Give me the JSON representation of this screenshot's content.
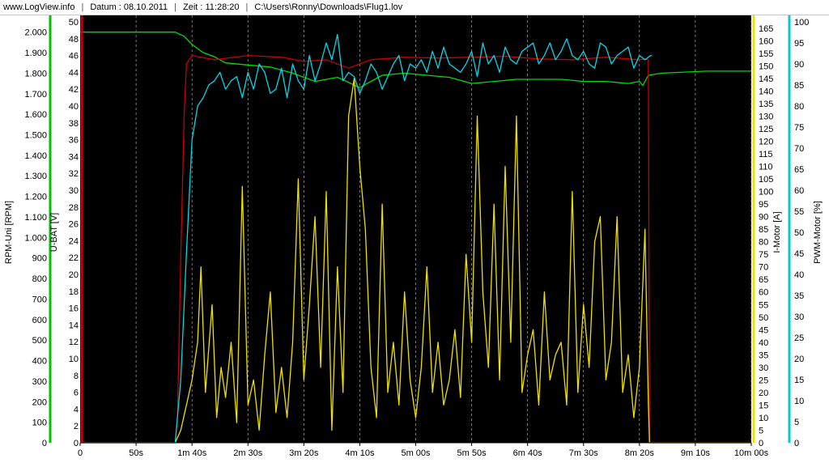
{
  "header": {
    "site": "www.LogView.info",
    "date": "Datum : 08.10.2011",
    "time": "Zeit : 11:28:20",
    "path": "C:\\Users\\Ronny\\Downloads\\Flug1.lov"
  },
  "chart_data": {
    "type": "line",
    "background": "#000000",
    "grid": true,
    "x_axis": {
      "unit": "s",
      "range": [
        0,
        600
      ],
      "ticks": [
        {
          "value": 0,
          "label": "0"
        },
        {
          "value": 50,
          "label": "50s"
        },
        {
          "value": 100,
          "label": "1m 40s"
        },
        {
          "value": 150,
          "label": "2m 30s"
        },
        {
          "value": 200,
          "label": "3m 20s"
        },
        {
          "value": 250,
          "label": "4m 10s"
        },
        {
          "value": 300,
          "label": "5m 00s"
        },
        {
          "value": 350,
          "label": "5m 50s"
        },
        {
          "value": 400,
          "label": "6m 40s"
        },
        {
          "value": 450,
          "label": "7m 30s"
        },
        {
          "value": 500,
          "label": "8m 20s"
        },
        {
          "value": 550,
          "label": "9m 10s"
        },
        {
          "value": 600,
          "label": "10m 00s"
        }
      ]
    },
    "y_axes": [
      {
        "id": "rpm",
        "label": "RPM-Uni [RPM]",
        "color": "#00c000",
        "range": [
          0,
          2050
        ],
        "ticks": [
          "0",
          "100",
          "200",
          "300",
          "400",
          "500",
          "600",
          "700",
          "800",
          "900",
          "1.000",
          "1.100",
          "1.200",
          "1.300",
          "1.400",
          "1.500",
          "1.600",
          "1.700",
          "1.800",
          "1.900",
          "2.000"
        ]
      },
      {
        "id": "ubat",
        "label": "U-BAT [V]",
        "color": "#cc0000",
        "range": [
          0,
          50
        ],
        "ticks": [
          "0",
          "2",
          "4",
          "6",
          "8",
          "10",
          "12",
          "14",
          "16",
          "18",
          "20",
          "22",
          "24",
          "26",
          "28",
          "30",
          "32",
          "34",
          "36",
          "38",
          "40",
          "42",
          "44",
          "46",
          "48",
          "50"
        ]
      },
      {
        "id": "imotor",
        "label": "I-Motor [A]",
        "color": "#f0e000",
        "range": [
          0,
          167.5
        ],
        "ticks": [
          "0",
          "5",
          "10",
          "15",
          "20",
          "25",
          "30",
          "35",
          "40",
          "45",
          "50",
          "55",
          "60",
          "65",
          "70",
          "75",
          "80",
          "85",
          "90",
          "95",
          "100",
          "105",
          "110",
          "115",
          "120",
          "125",
          "130",
          "135",
          "140",
          "145",
          "150",
          "155",
          "160",
          "165"
        ]
      },
      {
        "id": "pwm",
        "label": "PWM-Motor [%]",
        "color": "#00c8d8",
        "range": [
          0,
          100
        ],
        "ticks": [
          "0",
          "5",
          "10",
          "15",
          "20",
          "25",
          "30",
          "35",
          "40",
          "45",
          "50",
          "55",
          "60",
          "65",
          "70",
          "75",
          "80",
          "85",
          "90",
          "95",
          "100"
        ]
      }
    ],
    "series": [
      {
        "name": "RPM-Uni [RPM]",
        "axis": "rpm",
        "color": "#00dd00",
        "x": [
          0,
          85,
          93,
          100,
          110,
          120,
          130,
          150,
          170,
          190,
          210,
          230,
          250,
          270,
          290,
          310,
          330,
          350,
          370,
          390,
          410,
          430,
          450,
          470,
          490,
          500,
          503,
          508,
          520,
          540,
          560,
          580,
          600
        ],
        "y": [
          2000,
          2000,
          1980,
          1940,
          1900,
          1880,
          1850,
          1840,
          1830,
          1800,
          1760,
          1780,
          1730,
          1790,
          1800,
          1790,
          1780,
          1750,
          1760,
          1770,
          1770,
          1770,
          1760,
          1760,
          1750,
          1760,
          1740,
          1790,
          1800,
          1805,
          1810,
          1810,
          1810
        ]
      },
      {
        "name": "U-BAT [V]",
        "axis": "ubat",
        "color": "#cc0000",
        "x": [
          0,
          85,
          87,
          90,
          93,
          95,
          100,
          120,
          150,
          180,
          200,
          220,
          240,
          260,
          290,
          320,
          350,
          380,
          410,
          440,
          470,
          490,
          500,
          505,
          508,
          509,
          520,
          600
        ],
        "y": [
          0,
          0,
          3,
          22,
          39,
          45,
          46,
          45.5,
          46,
          45.8,
          45.3,
          45.5,
          44.5,
          45.5,
          45.8,
          45.7,
          45.8,
          45.9,
          45.6,
          45.5,
          45.8,
          45.6,
          45.5,
          45.6,
          45.5,
          0,
          0,
          0
        ]
      },
      {
        "name": "I-Motor [A]",
        "axis": "imotor",
        "color": "#f0e000",
        "x": [
          0,
          85,
          90,
          95,
          100,
          105,
          108,
          112,
          118,
          122,
          126,
          130,
          135,
          140,
          145,
          150,
          155,
          160,
          165,
          170,
          175,
          180,
          185,
          190,
          195,
          200,
          205,
          210,
          215,
          220,
          225,
          230,
          235,
          240,
          245,
          250,
          255,
          260,
          265,
          270,
          275,
          280,
          285,
          290,
          295,
          300,
          305,
          310,
          315,
          320,
          325,
          330,
          335,
          340,
          345,
          350,
          355,
          360,
          365,
          370,
          375,
          380,
          385,
          390,
          395,
          400,
          405,
          410,
          415,
          420,
          425,
          430,
          435,
          440,
          445,
          450,
          455,
          460,
          465,
          470,
          475,
          480,
          485,
          490,
          495,
          500,
          505,
          508,
          509,
          600
        ],
        "y": [
          0,
          0,
          5,
          15,
          25,
          40,
          70,
          20,
          55,
          10,
          30,
          18,
          40,
          8,
          102,
          15,
          25,
          5,
          35,
          60,
          12,
          30,
          10,
          40,
          105,
          25,
          55,
          90,
          30,
          100,
          5,
          70,
          20,
          130,
          145,
          110,
          85,
          30,
          10,
          95,
          20,
          40,
          15,
          60,
          25,
          10,
          30,
          70,
          20,
          40,
          15,
          25,
          45,
          18,
          75,
          40,
          130,
          60,
          30,
          95,
          25,
          110,
          40,
          130,
          20,
          35,
          45,
          15,
          60,
          25,
          35,
          40,
          15,
          100,
          20,
          55,
          30,
          80,
          90,
          25,
          40,
          90,
          20,
          35,
          10,
          30,
          85,
          15,
          0,
          0
        ]
      },
      {
        "name": "PWM-Motor [%]",
        "axis": "pwm",
        "color": "#00d8e8",
        "x": [
          0,
          85,
          90,
          95,
          100,
          105,
          110,
          115,
          120,
          125,
          130,
          135,
          140,
          145,
          150,
          155,
          160,
          165,
          170,
          175,
          180,
          185,
          190,
          195,
          200,
          205,
          210,
          215,
          220,
          225,
          230,
          235,
          240,
          245,
          250,
          255,
          260,
          265,
          270,
          275,
          280,
          285,
          290,
          295,
          300,
          305,
          310,
          315,
          320,
          325,
          330,
          335,
          340,
          345,
          350,
          355,
          360,
          365,
          370,
          375,
          380,
          385,
          390,
          395,
          400,
          405,
          410,
          415,
          420,
          425,
          430,
          435,
          440,
          445,
          450,
          455,
          460,
          465,
          470,
          475,
          480,
          485,
          490,
          495,
          500,
          505,
          510,
          511
        ],
        "y": [
          0,
          0,
          15,
          45,
          72,
          80,
          82,
          85,
          86,
          88,
          84,
          86,
          87,
          82,
          88,
          84,
          90,
          88,
          83,
          84,
          89,
          82,
          90,
          86,
          84,
          92,
          86,
          90,
          95,
          91,
          97,
          86,
          88,
          87,
          83,
          86,
          90,
          88,
          84,
          87,
          90,
          92,
          86,
          90,
          89,
          91,
          88,
          93,
          89,
          94,
          90,
          89,
          88,
          90,
          93,
          87,
          95,
          90,
          92,
          88,
          94,
          91,
          90,
          93,
          94,
          95,
          90,
          92,
          95,
          91,
          93,
          96,
          92,
          91,
          93,
          90,
          89,
          95,
          94,
          90,
          92,
          93,
          94,
          89,
          92,
          91,
          92,
          92
        ]
      }
    ]
  }
}
